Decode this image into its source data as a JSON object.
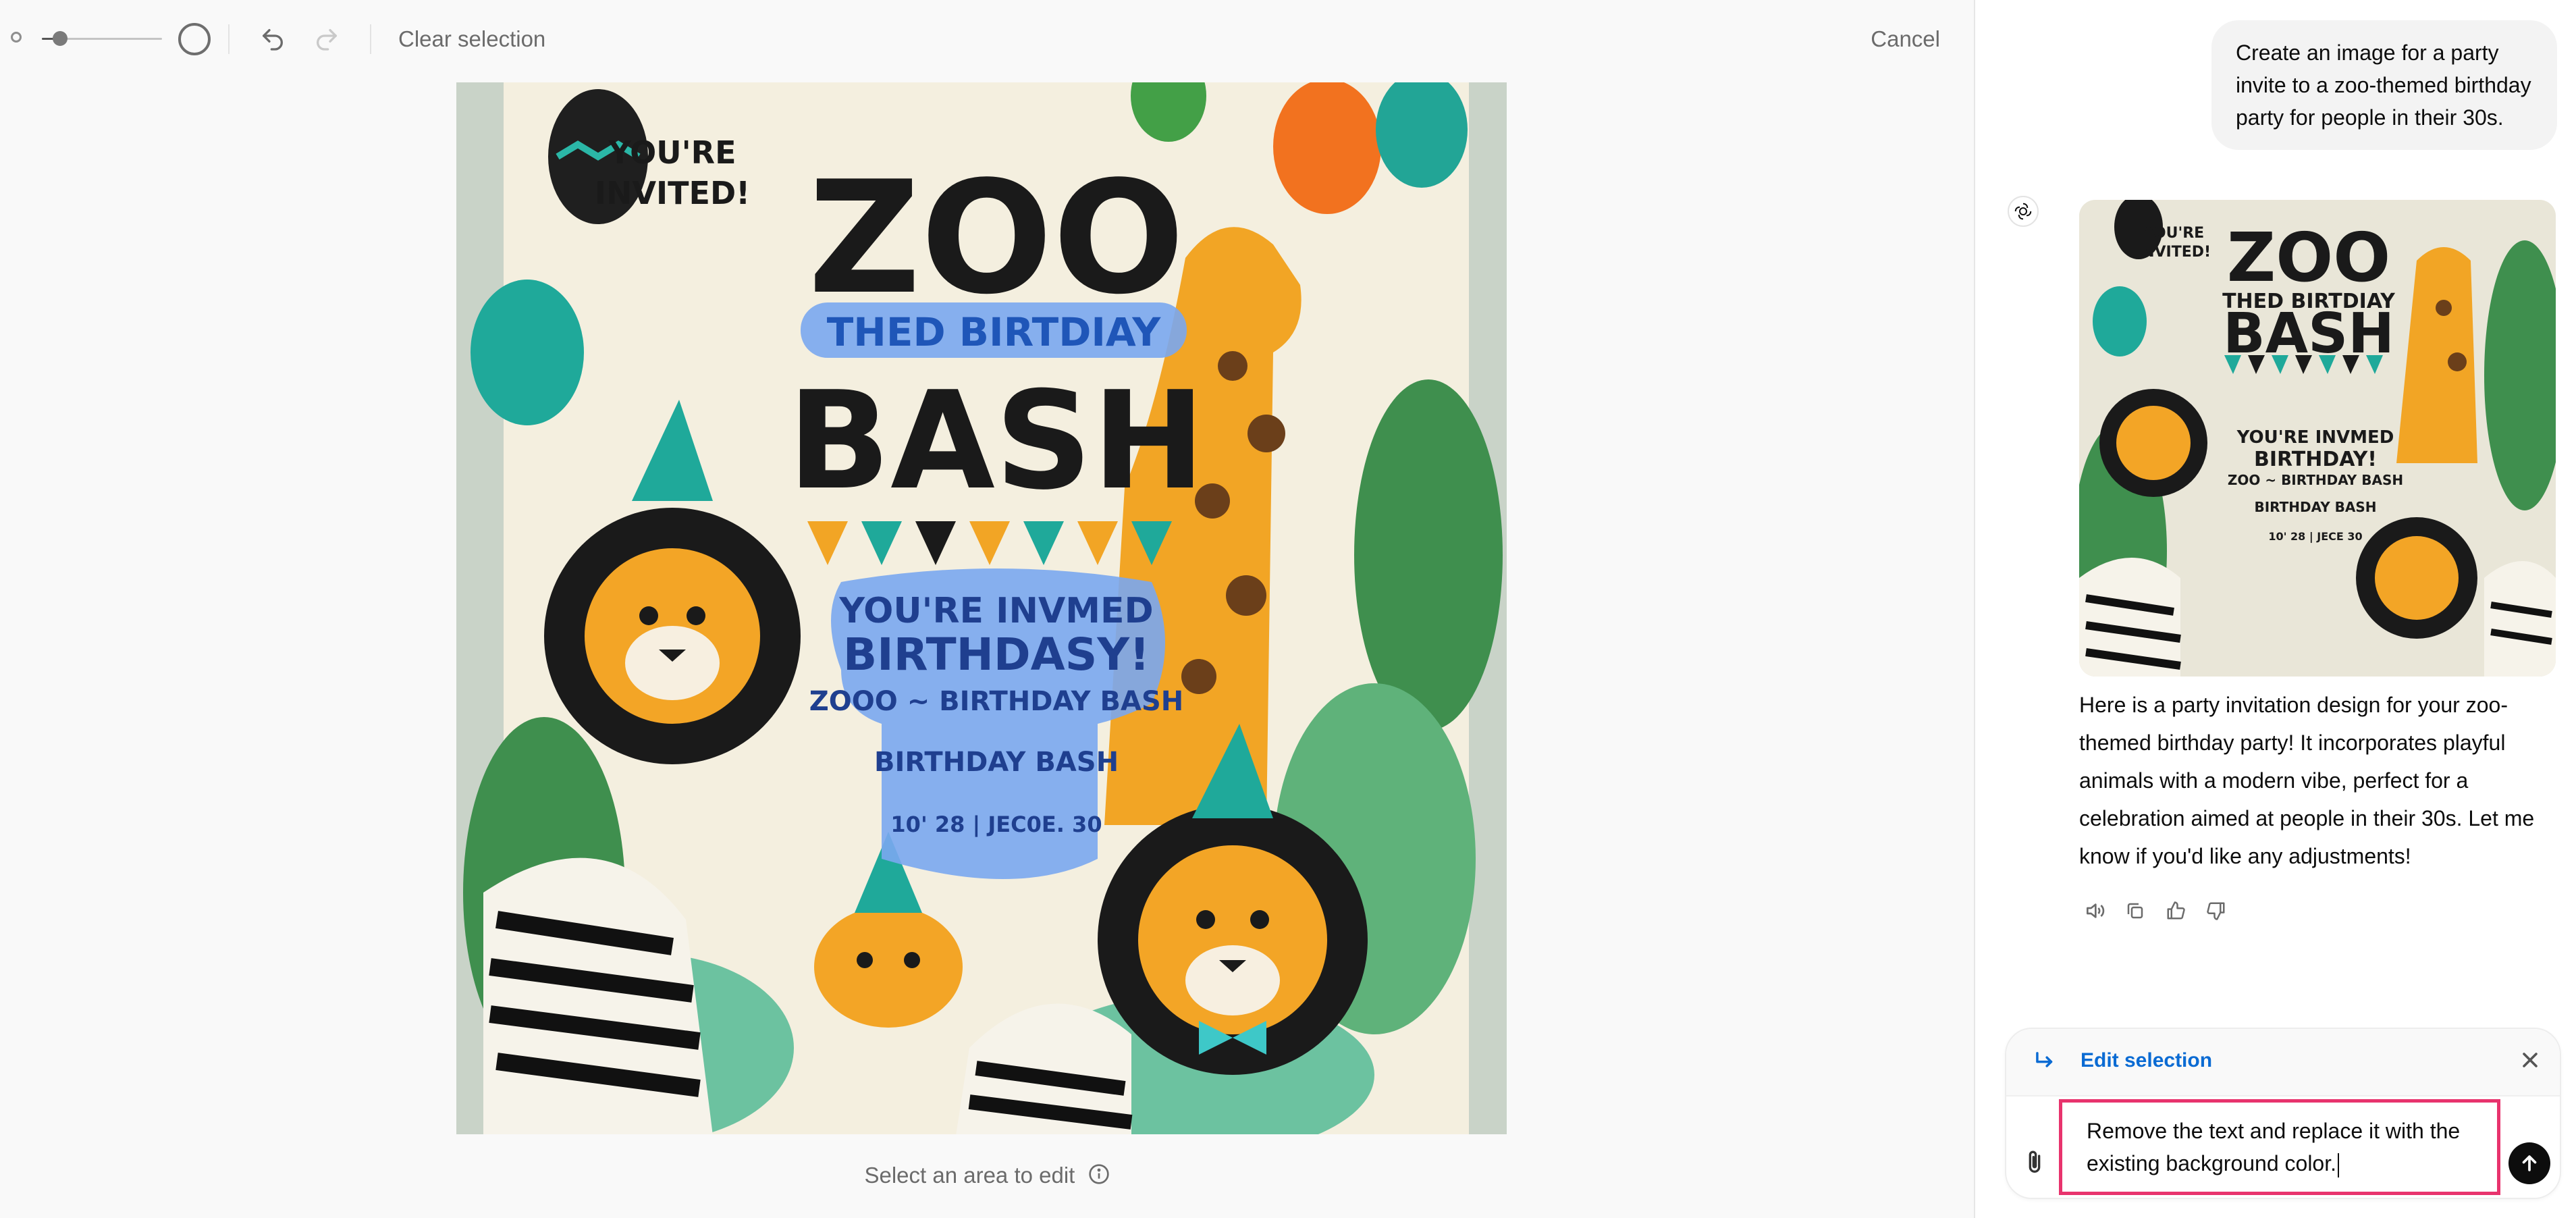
{
  "toolbar": {
    "clear_selection": "Clear selection",
    "cancel": "Cancel",
    "brush_size_level": 0.15
  },
  "canvas": {
    "hint": "Select an area to edit",
    "poster": {
      "invited": [
        "YOU'RE",
        "INVITED!"
      ],
      "zoo": "ZOO",
      "themed": "THED BIRTDIAY",
      "bash": "BASH",
      "invite_line1": "YOU'RE INVMED",
      "invite_line2": "BIRTHDASY!",
      "invite_line3": "ZOOO ~ BIRTHDAY BASH",
      "invite_line4": "BIRTHDAY BASH",
      "date": "10' 28   |   JEC0E. 30"
    }
  },
  "chat": {
    "user_message": "Create an image for a party invite to a zoo-themed birthday party for people in their 30s.",
    "assistant_message": "Here is a party invitation design for your zoo-themed birthday party! It incorporates playful animals with a modern vibe, perfect for a celebration aimed at people in their 30s. Let me know if you'd like any adjustments!",
    "thumb_text": {
      "invited": [
        "YOU'RE",
        "INVITED!"
      ],
      "zoo": "ZOO",
      "themed": "THED BIRTDIAY",
      "bash": "BASH",
      "line1": "YOU'RE INVMED",
      "line2": "BIRTHDAY!",
      "line3": "ZOO ~ BIRTHDAY BASH",
      "line4": "BIRTHDAY BASH",
      "date": "10' 28  |  JECE 30"
    },
    "actions": [
      "speaker-icon",
      "copy-icon",
      "thumbs-up-icon",
      "thumbs-down-icon"
    ]
  },
  "composer": {
    "edit_selection_label": "Edit selection",
    "prompt_value": "Remove the text and replace it with the existing background color."
  },
  "colors": {
    "accent_link": "#0b6bd3",
    "highlight_border": "#e8336d",
    "selection_blue": "#7aa7ef"
  }
}
